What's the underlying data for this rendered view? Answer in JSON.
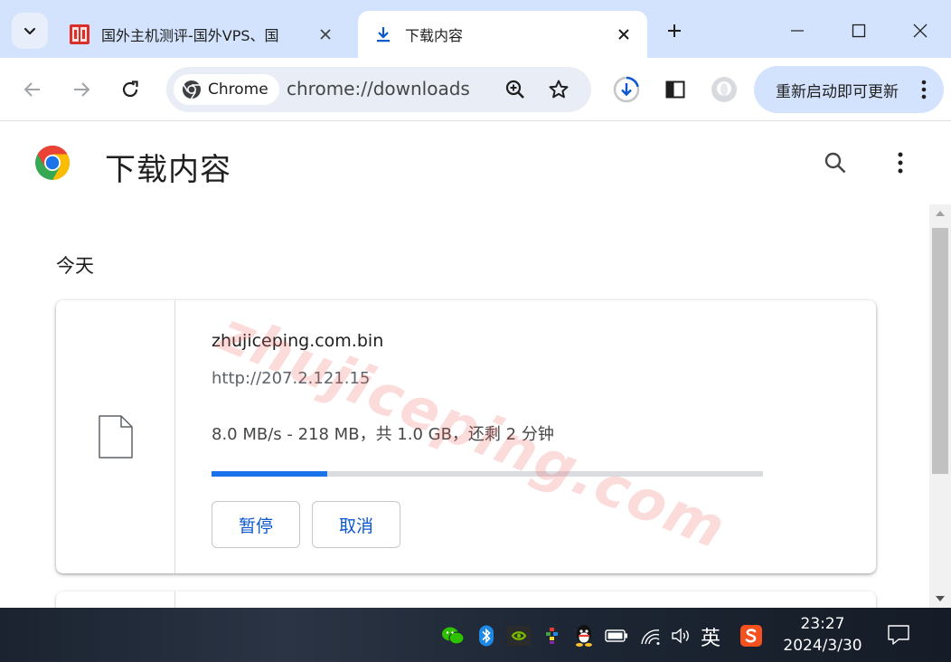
{
  "tabs": [
    {
      "title": "国外主机测评-国外VPS、国",
      "active": false
    },
    {
      "title": "下载内容",
      "active": true
    }
  ],
  "omnibox": {
    "chip_label": "Chrome",
    "url": "chrome://downloads"
  },
  "toolbar": {
    "update_label": "重新启动即可更新"
  },
  "page": {
    "title": "下载内容",
    "section": "今天"
  },
  "download": {
    "filename": "zhujiceping.com.bin",
    "source_url": "http://207.2.121.15",
    "status": "8.0 MB/s - 218 MB，共 1.0 GB，还剩 2 分钟",
    "progress_percent": 21,
    "pause_label": "暂停",
    "cancel_label": "取消"
  },
  "watermark": "zhujiceping.com",
  "taskbar": {
    "ime": "英",
    "time": "23:27",
    "date": "2024/3/30"
  },
  "colors": {
    "accent": "#1a73e8",
    "tabstrip": "#d3e3fd",
    "button_text": "#0b57d0"
  }
}
